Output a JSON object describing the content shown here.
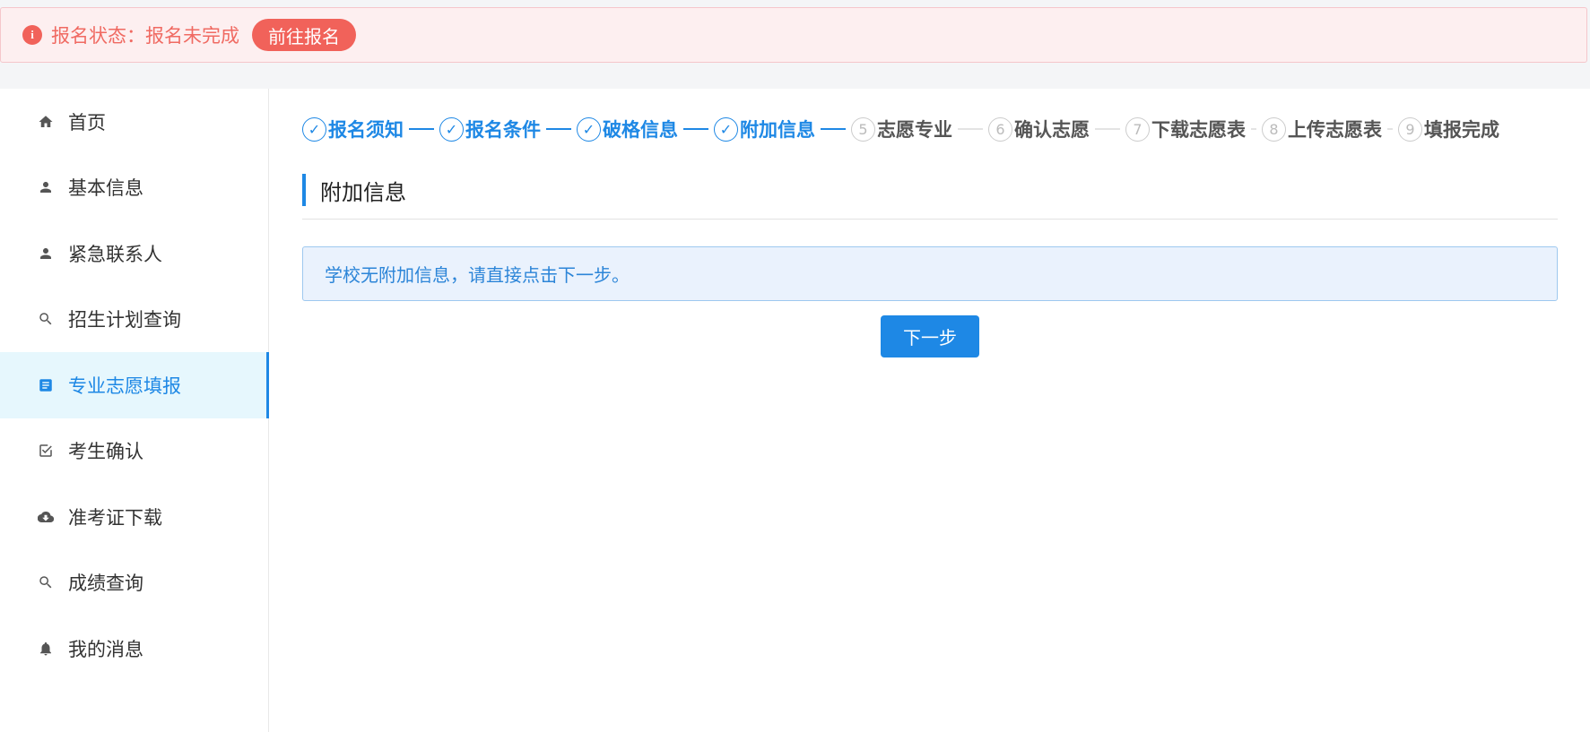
{
  "alert": {
    "icon": "info-icon",
    "text": "报名状态：报名未完成",
    "button_label": "前往报名",
    "color": "#f1625a"
  },
  "sidebar": {
    "items": [
      {
        "label": "首页",
        "icon": "home-icon",
        "active": false
      },
      {
        "label": "基本信息",
        "icon": "person-icon",
        "active": false
      },
      {
        "label": "紧急联系人",
        "icon": "person-icon",
        "active": false
      },
      {
        "label": "招生计划查询",
        "icon": "search-icon",
        "active": false
      },
      {
        "label": "专业志愿填报",
        "icon": "document-icon",
        "active": true
      },
      {
        "label": "考生确认",
        "icon": "checkbox-icon",
        "active": false
      },
      {
        "label": "准考证下载",
        "icon": "cloud-download-icon",
        "active": false
      },
      {
        "label": "成绩查询",
        "icon": "search-icon",
        "active": false
      },
      {
        "label": "我的消息",
        "icon": "bell-icon",
        "active": false
      }
    ]
  },
  "steps": [
    {
      "num": "✓",
      "label": "报名须知",
      "status": "done"
    },
    {
      "num": "✓",
      "label": "报名条件",
      "status": "done"
    },
    {
      "num": "✓",
      "label": "破格信息",
      "status": "done"
    },
    {
      "num": "✓",
      "label": "附加信息",
      "status": "done"
    },
    {
      "num": "5",
      "label": "志愿专业",
      "status": "todo"
    },
    {
      "num": "6",
      "label": "确认志愿",
      "status": "todo"
    },
    {
      "num": "7",
      "label": "下载志愿表",
      "status": "todo"
    },
    {
      "num": "8",
      "label": "上传志愿表",
      "status": "todo"
    },
    {
      "num": "9",
      "label": "填报完成",
      "status": "todo"
    }
  ],
  "main": {
    "section_title": "附加信息",
    "info_text": "学校无附加信息，请直接点击下一步。",
    "next_label": "下一步"
  },
  "colors": {
    "primary": "#1e88e5",
    "alert": "#f1625a",
    "active_bg": "#e6f7fd"
  }
}
